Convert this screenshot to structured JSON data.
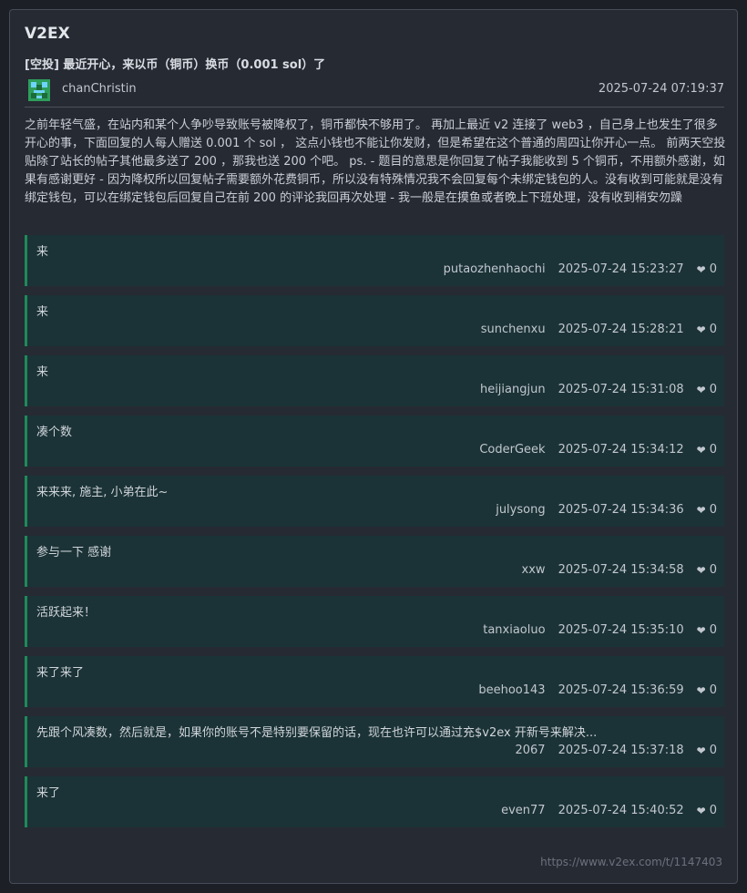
{
  "header": {
    "site_name": "V2EX",
    "topic_title": "[空投] 最近开心，来以币（铜币）换币（0.001 sol）了"
  },
  "author": {
    "name": "chanChristin",
    "posted_at": "2025-07-24 07:19:37",
    "avatar_icon": "pixel-avatar-icon"
  },
  "content": "之前年轻气盛，在站内和某个人争吵导致账号被降权了，铜币都快不够用了。 再加上最近 v2 连接了 web3 ，自己身上也发生了很多开心的事，下面回复的人每人赠送 0.001 个 sol ， 这点小钱也不能让你发财，但是希望在这个普通的周四让你开心一点。 前两天空投贴除了站长的帖子其他最多送了 200 ，那我也送 200 个吧。 ps. - 题目的意思是你回复了帖子我能收到 5 个铜币，不用额外感谢，如果有感谢更好 - 因为降权所以回复帖子需要额外花费铜币，所以没有特殊情况我不会回复每个未绑定钱包的人。没有收到可能就是没有绑定钱包，可以在绑定钱包后回复自己在前 200 的评论我回再次处理 - 我一般是在摸鱼或者晚上下班处理，没有收到稍安勿躁",
  "replies": [
    {
      "text": "来",
      "user": "putaozhenhaochi",
      "time": "2025-07-24 15:23:27",
      "likes": "0"
    },
    {
      "text": "来",
      "user": "sunchenxu",
      "time": "2025-07-24 15:28:21",
      "likes": "0"
    },
    {
      "text": "来",
      "user": "heijiangjun",
      "time": "2025-07-24 15:31:08",
      "likes": "0"
    },
    {
      "text": "凑个数",
      "user": "CoderGeek",
      "time": "2025-07-24 15:34:12",
      "likes": "0"
    },
    {
      "text": "来来来, 施主, 小弟在此~",
      "user": "julysong",
      "time": "2025-07-24 15:34:36",
      "likes": "0"
    },
    {
      "text": "参与一下 感谢",
      "user": "xxw",
      "time": "2025-07-24 15:34:58",
      "likes": "0"
    },
    {
      "text": "活跃起来！",
      "user": "tanxiaoluo",
      "time": "2025-07-24 15:35:10",
      "likes": "0"
    },
    {
      "text": "来了来了",
      "user": "beehoo143",
      "time": "2025-07-24 15:36:59",
      "likes": "0"
    },
    {
      "text": "先跟个风凑数，然后就是，如果你的账号不是特别要保留的话，现在也许可以通过充$v2ex 开新号来解决...",
      "user": "2067",
      "time": "2025-07-24 15:37:18",
      "likes": "0"
    },
    {
      "text": "来了",
      "user": "even77",
      "time": "2025-07-24 15:40:52",
      "likes": "0"
    }
  ],
  "footer": {
    "url": "https://www.v2ex.com/t/1147403"
  },
  "colors": {
    "background": "#1c1f26",
    "card": "#262a33",
    "reply_background": "#1b3336",
    "reply_accent": "#1e8a5a"
  }
}
